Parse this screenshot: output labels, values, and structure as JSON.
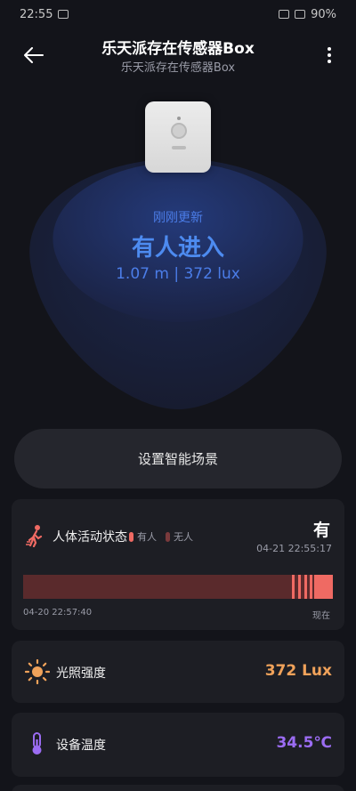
{
  "status_bar": {
    "time": "22:55",
    "battery": "90%"
  },
  "header": {
    "title": "乐天派存在传感器Box",
    "subtitle": "乐天派存在传感器Box"
  },
  "hero": {
    "updated": "刚刚更新",
    "state": "有人进入",
    "readings": "1.07  m | 372 lux"
  },
  "scene_button": {
    "label": "设置智能场景"
  },
  "activity": {
    "title": "人体活动状态",
    "legend_present": "有人",
    "legend_absent": "无人",
    "value": "有",
    "timestamp": "04-21 22:55:17",
    "timeline_start": "04-20 22:57:40",
    "timeline_end": "现在",
    "present_fraction": 0.13
  },
  "light": {
    "label": "光照强度",
    "value": "372 Lux",
    "color": "#f0a25a"
  },
  "temperature": {
    "label": "设备温度",
    "value": "34.5℃",
    "color": "#9b6cf2"
  },
  "colors": {
    "present": "#ef6a63",
    "absent": "#5a2a2c",
    "accent_blue": "#4d8bf0"
  },
  "icons": [
    "back-arrow-icon",
    "more-vertical-icon",
    "walking-person-icon",
    "sun-icon",
    "thermometer-icon"
  ]
}
